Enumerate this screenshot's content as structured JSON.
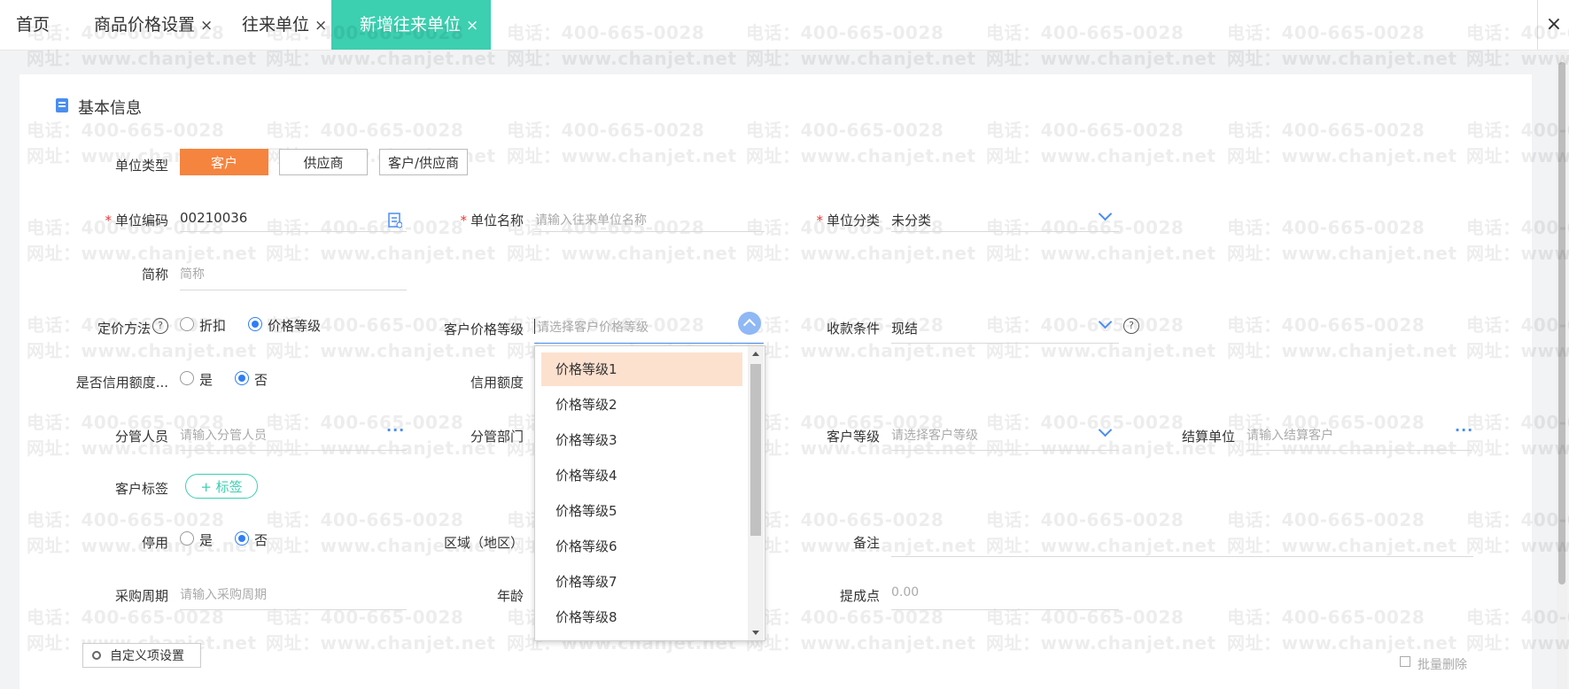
{
  "tabs": [
    {
      "label": "首页",
      "closable": false
    },
    {
      "label": "商品价格设置",
      "closable": true
    },
    {
      "label": "往来单位",
      "closable": true
    },
    {
      "label": "新增往来单位",
      "closable": true,
      "active": true
    }
  ],
  "close_symbol": "×",
  "section": {
    "title": "基本信息",
    "icon": "document-icon"
  },
  "unit_type": {
    "label": "单位类型",
    "options": [
      "客户",
      "供应商",
      "客户/供应商"
    ],
    "selected": "客户"
  },
  "fields": {
    "unit_code": {
      "label": "单位编码",
      "required": true,
      "value": "00210036"
    },
    "unit_name": {
      "label": "单位名称",
      "required": true,
      "placeholder": "请输入往来单位名称"
    },
    "unit_category": {
      "label": "单位分类",
      "required": true,
      "value": "未分类"
    },
    "short_name": {
      "label": "简称",
      "placeholder": "简称"
    },
    "pricing_method": {
      "label": "定价方法",
      "options": [
        "折扣",
        "价格等级"
      ],
      "selected": "价格等级"
    },
    "customer_price_level": {
      "label": "客户价格等级",
      "placeholder": "请选择客户价格等级"
    },
    "payment_terms": {
      "label": "收款条件",
      "value": "现结"
    },
    "credit_limit_enabled": {
      "label": "是否信用额度...",
      "options": [
        "是",
        "否"
      ],
      "selected": "否"
    },
    "credit_limit": {
      "label": "信用额度"
    },
    "manager": {
      "label": "分管人员",
      "placeholder": "请输入分管人员"
    },
    "department": {
      "label": "分管部门"
    },
    "customer_level": {
      "label": "客户等级",
      "placeholder": "请选择客户等级"
    },
    "settlement_unit": {
      "label": "结算单位",
      "placeholder": "请输入结算客户"
    },
    "customer_tag": {
      "label": "客户标签",
      "button": "+ 标签"
    },
    "disabled": {
      "label": "停用",
      "options": [
        "是",
        "否"
      ],
      "selected": "否"
    },
    "region": {
      "label": "区域（地区）"
    },
    "remark": {
      "label": "备注"
    },
    "purchase_cycle": {
      "label": "采购周期",
      "placeholder": "请输入采购周期"
    },
    "age": {
      "label": "年龄"
    },
    "commission": {
      "label": "提成点",
      "placeholder": "0.00"
    }
  },
  "price_level_dropdown": {
    "options": [
      "价格等级1",
      "价格等级2",
      "价格等级3",
      "价格等级4",
      "价格等级5",
      "价格等级6",
      "价格等级7",
      "价格等级8"
    ],
    "highlighted": "价格等级1"
  },
  "buttons": {
    "custom_fields": "自定义项设置",
    "batch_delete": "批量删除"
  },
  "watermark": {
    "phone": "电话：400-665-0028",
    "site": "网址：www.chanjet.net"
  },
  "colors": {
    "accent_tab": "#3ccfb0",
    "selected_type": "#f5843f",
    "link_blue": "#4a8ef0",
    "required": "#e53935",
    "dropdown_highlight": "#fde1cf"
  }
}
